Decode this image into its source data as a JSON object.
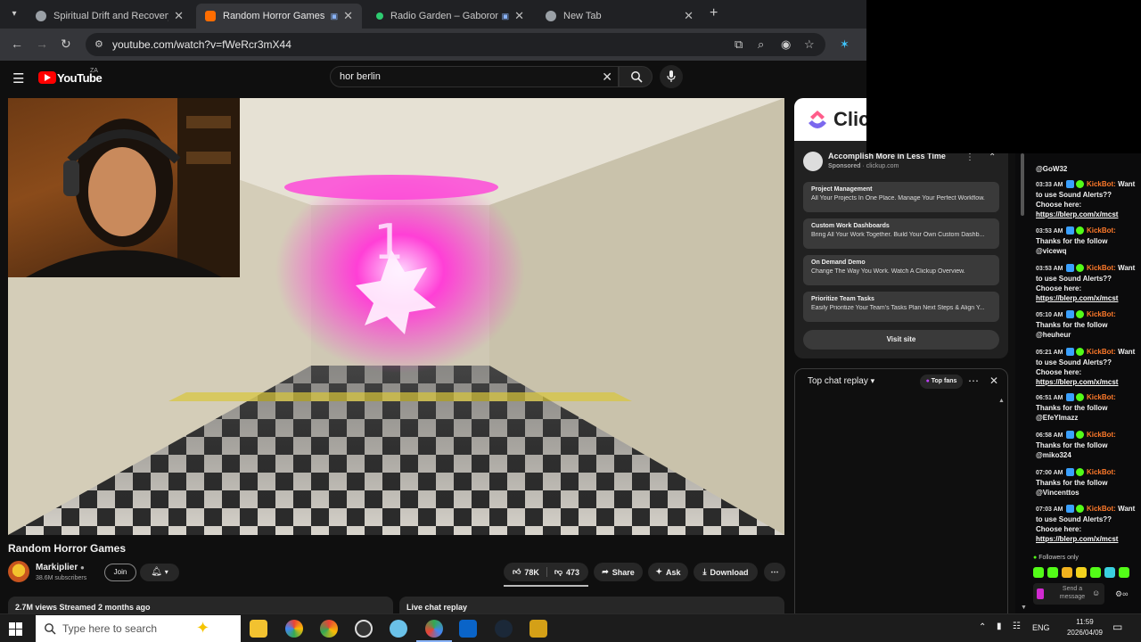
{
  "browser": {
    "tabs": [
      {
        "title": "Spiritual Drift and Recovery",
        "favicon_color": "#9aa0a6",
        "active": false
      },
      {
        "title": "Random Horror Games - Yo",
        "favicon_color": "#ff6d00",
        "active": true
      },
      {
        "title": "Radio Garden – Gaborone",
        "favicon_color": "#2ecc71",
        "active": false
      },
      {
        "title": "New Tab",
        "favicon_color": "#9aa0a6",
        "active": false
      }
    ],
    "url": "youtube.com/watch?v=fWeRcr3mX44"
  },
  "youtube": {
    "wordmark": "YouTube",
    "country": "ZA",
    "search_query": "hor berlin"
  },
  "video": {
    "title": "Random Horror Games",
    "channel": "Markiplier",
    "subscribers": "38.6M subscribers",
    "join_label": "Join",
    "likes": "78K",
    "dislikes": "473",
    "share_label": "Share",
    "ask_label": "Ask",
    "download_label": "Download",
    "stats": "2.7M views  Streamed 2 months ago",
    "live_chat_replay_label": "Live chat replay",
    "scene_number": "1"
  },
  "ad": {
    "brand": "Clic",
    "headline": "Accomplish More in Less Time",
    "sponsored": "Sponsored",
    "domain": "clickup.com",
    "links": [
      {
        "title": "Project Management",
        "desc": "All Your Projects In One Place. Manage Your Perfect Workflow."
      },
      {
        "title": "Custom Work Dashboards",
        "desc": "Bring All Your Work Together. Build Your Own Custom Dashb..."
      },
      {
        "title": "On Demand Demo",
        "desc": "Change The Way You Work. Watch A Clickup Overview."
      },
      {
        "title": "Prioritize Team Tasks",
        "desc": "Easily Prioritize Your Team's Tasks Plan Next Steps & Align Y..."
      }
    ],
    "visit_label": "Visit site"
  },
  "chat_replay": {
    "header": "Top chat replay",
    "filter": "Top fans"
  },
  "kick_chat": {
    "top_text": "@GoW32",
    "messages": [
      {
        "time": "03:33 AM",
        "bot": "KickBot:",
        "text": "Want to use Sound Alerts?? Choose here:",
        "link": "https://blerp.com/x/mcst"
      },
      {
        "time": "03:53 AM",
        "bot": "KickBot:",
        "text": "Thanks for the follow @vicewq",
        "link": ""
      },
      {
        "time": "03:53 AM",
        "bot": "KickBot:",
        "text": "Want to use Sound Alerts?? Choose here:",
        "link": "https://blerp.com/x/mcst"
      },
      {
        "time": "05:10 AM",
        "bot": "KickBot:",
        "text": "Thanks for the follow @heuheur",
        "link": ""
      },
      {
        "time": "05:21 AM",
        "bot": "KickBot:",
        "text": "Want to use Sound Alerts?? Choose here:",
        "link": "https://blerp.com/x/mcst"
      },
      {
        "time": "06:51 AM",
        "bot": "KickBot:",
        "text": "Thanks for the follow @EfeYlmazz",
        "link": ""
      },
      {
        "time": "06:58 AM",
        "bot": "KickBot:",
        "text": "Thanks for the follow @miko324",
        "link": ""
      },
      {
        "time": "07:00 AM",
        "bot": "KickBot:",
        "text": "Thanks for the follow @Vincenttos",
        "link": ""
      },
      {
        "time": "07:03 AM",
        "bot": "KickBot:",
        "text": "Want to use Sound Alerts?? Choose here:",
        "link": "https://blerp.com/x/mcst"
      }
    ],
    "followers_only": "Followers only",
    "send_placeholder": "Send a message"
  },
  "taskbar": {
    "search_placeholder": "Type here to search",
    "language": "ENG",
    "time": "11:59",
    "date": "2026/04/09",
    "apps": [
      "sparkle",
      "file-explorer",
      "chrome-canary",
      "chrome",
      "obs",
      "snip",
      "chrome-alt",
      "outlook",
      "steam",
      "app-yellow"
    ]
  }
}
